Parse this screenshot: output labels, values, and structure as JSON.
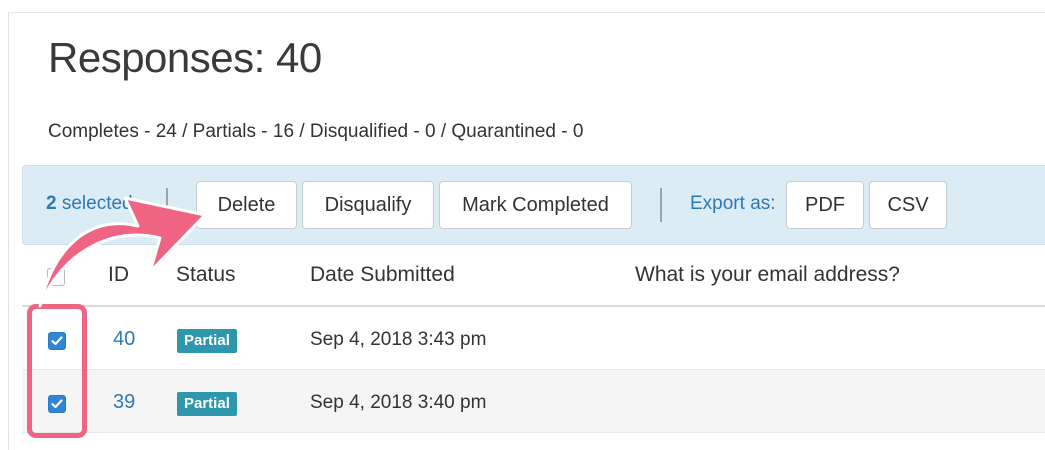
{
  "page": {
    "title": "Responses: 40",
    "summary": "Completes - 24 / Partials - 16 / Disqualified - 0 / Quarantined - 0"
  },
  "toolbar": {
    "selected_count": "2",
    "selected_suffix": " selected",
    "delete_label": "Delete",
    "disqualify_label": "Disqualify",
    "mark_completed_label": "Mark Completed",
    "export_label": "Export as:",
    "pdf_label": "PDF",
    "csv_label": "CSV"
  },
  "table": {
    "columns": {
      "id": "ID",
      "status": "Status",
      "date": "Date Submitted",
      "email": "What is your email address?"
    },
    "rows": [
      {
        "id": "40",
        "status": "Partial",
        "date": "Sep 4, 2018 3:43 pm",
        "checked": true
      },
      {
        "id": "39",
        "status": "Partial",
        "date": "Sep 4, 2018 3:40 pm",
        "checked": true
      }
    ]
  },
  "annotation": {
    "highlight_color": "#ee6482",
    "arrow_icon": "curved-arrow-icon"
  },
  "colors": {
    "accent": "#2c79b7",
    "toolbar_bg": "#dcecf5",
    "badge_bg": "#2f97ad",
    "checkbox_checked": "#2f86d8"
  }
}
